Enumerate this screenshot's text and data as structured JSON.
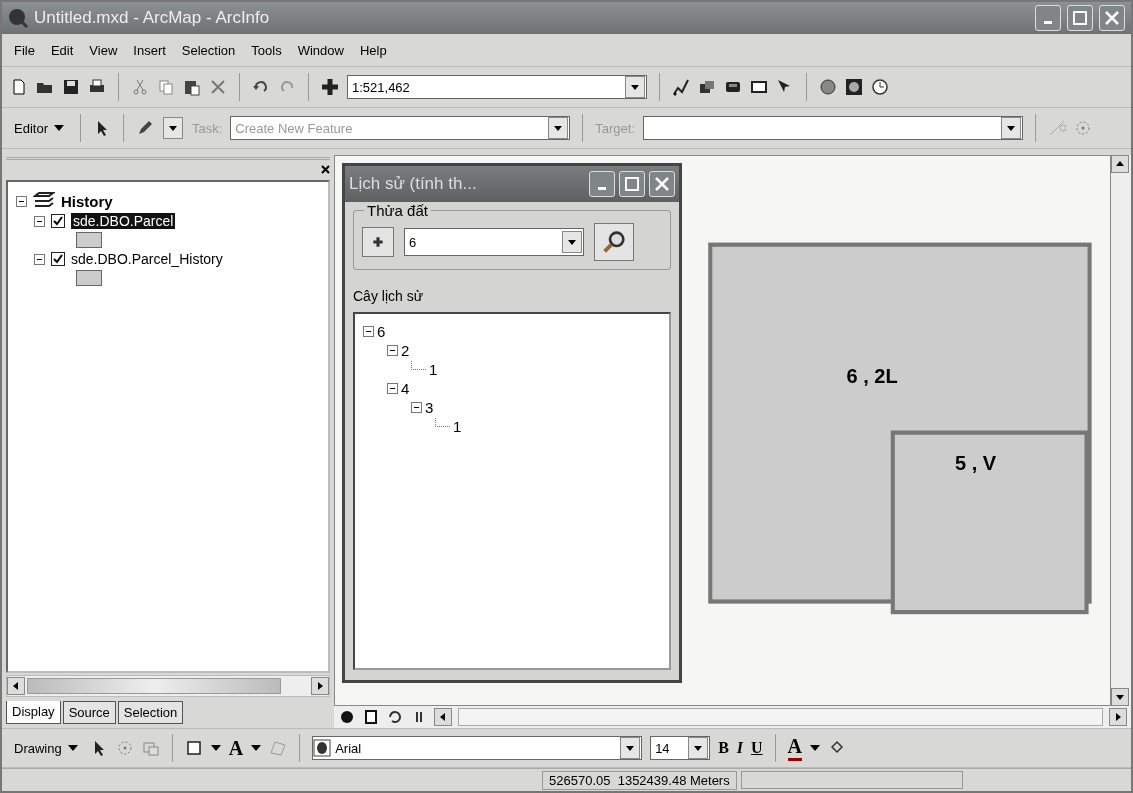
{
  "window": {
    "title": "Untitled.mxd - ArcMap - ArcInfo"
  },
  "menu": [
    "File",
    "Edit",
    "View",
    "Insert",
    "Selection",
    "Tools",
    "Window",
    "Help"
  ],
  "standard_toolbar": {
    "scale": "1:521,462"
  },
  "editor_toolbar": {
    "editor": "Editor",
    "task_label": "Task:",
    "task": "Create New Feature",
    "target_label": "Target:"
  },
  "toc": {
    "root": {
      "label": "History",
      "expanded": true
    },
    "layers": [
      {
        "label": "sde.DBO.Parcel",
        "checked": true,
        "selected": true,
        "expanded": true
      },
      {
        "label": "sde.DBO.Parcel_History",
        "checked": true,
        "selected": false,
        "expanded": true
      }
    ],
    "tabs": [
      {
        "label": "Display",
        "selected": true
      },
      {
        "label": "Source",
        "selected": false
      },
      {
        "label": "Selection",
        "selected": false
      }
    ]
  },
  "dialog": {
    "title": "Lịch sử (tính th...",
    "group_label": "Thửa đất",
    "parcel": "6",
    "tree_label": "Cây lịch sử",
    "tree": [
      {
        "label": "6",
        "children": [
          {
            "label": "2",
            "children": [
              {
                "label": "1"
              }
            ]
          },
          {
            "label": "4",
            "children": [
              {
                "label": "3",
                "children": [
                  {
                    "label": "1"
                  }
                ]
              }
            ]
          }
        ]
      }
    ]
  },
  "map": {
    "parcels": [
      {
        "label": "6 , 2L"
      },
      {
        "label": "5 , V"
      }
    ]
  },
  "drawing_toolbar": {
    "drawing": "Drawing",
    "text_tool": "A",
    "font": "Arial",
    "size": "14",
    "bold": "B",
    "italic": "I",
    "underline": "U",
    "font_color": "A"
  },
  "status_bar": {
    "coordinates": "526570.05  1352439.48 Meters"
  }
}
